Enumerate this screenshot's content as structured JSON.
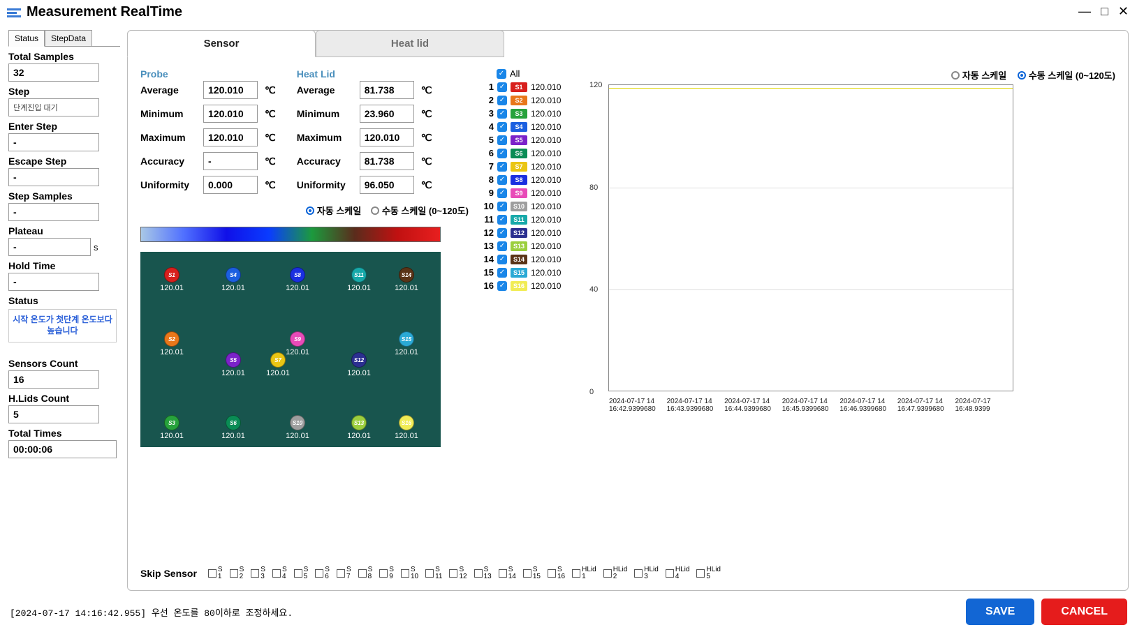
{
  "title": "Measurement RealTime",
  "window": {
    "min": "—",
    "max": "□",
    "close": "✕"
  },
  "side_tabs": {
    "status": "Status",
    "stepdata": "StepData"
  },
  "sidebar": {
    "total_samples_label": "Total Samples",
    "total_samples": "32",
    "step_label": "Step",
    "step": "단계진입 대기",
    "enter_step_label": "Enter Step",
    "enter_step": "-",
    "escape_step_label": "Escape Step",
    "escape_step": "-",
    "step_samples_label": "Step Samples",
    "step_samples": "-",
    "plateau_label": "Plateau",
    "plateau": "-",
    "plateau_unit": "s",
    "hold_time_label": "Hold Time",
    "hold_time": "-",
    "status_label": "Status",
    "status_text": "시작 온도가 첫단계 온도보다 높습니다",
    "sensors_count_label": "Sensors Count",
    "sensors_count": "16",
    "hlids_count_label": "H.Lids Count",
    "hlids_count": "5",
    "total_times_label": "Total Times",
    "total_times": "00:00:06"
  },
  "main_tabs": {
    "sensor": "Sensor",
    "heatlid": "Heat lid"
  },
  "stats": {
    "probe_title": "Probe",
    "heatlid_title": "Heat Lid",
    "avg_label": "Average",
    "min_label": "Minimum",
    "max_label": "Maximum",
    "acc_label": "Accuracy",
    "uni_label": "Uniformity",
    "unit": "℃",
    "probe": {
      "avg": "120.010",
      "min": "120.010",
      "max": "120.010",
      "acc": "-",
      "uni": "0.000"
    },
    "heatlid": {
      "avg": "81.738",
      "min": "23.960",
      "max": "120.010",
      "acc": "81.738",
      "uni": "96.050"
    }
  },
  "scale": {
    "auto": "자동 스케일",
    "manual": "수동 스케일 (0~120도)"
  },
  "all_label": "All",
  "sensors": [
    {
      "n": "1",
      "id": "S1",
      "v": "120.010",
      "c": "#d8201d"
    },
    {
      "n": "2",
      "id": "S2",
      "v": "120.010",
      "c": "#e8771a"
    },
    {
      "n": "3",
      "id": "S3",
      "v": "120.010",
      "c": "#27a23c"
    },
    {
      "n": "4",
      "id": "S4",
      "v": "120.010",
      "c": "#1b5fe0"
    },
    {
      "n": "5",
      "id": "S5",
      "v": "120.010",
      "c": "#7b22c9"
    },
    {
      "n": "6",
      "id": "S6",
      "v": "120.010",
      "c": "#0a8c55"
    },
    {
      "n": "7",
      "id": "S7",
      "v": "120.010",
      "c": "#eac514"
    },
    {
      "n": "8",
      "id": "S8",
      "v": "120.010",
      "c": "#1a2fe0"
    },
    {
      "n": "9",
      "id": "S9",
      "v": "120.010",
      "c": "#e84bb8"
    },
    {
      "n": "10",
      "id": "S10",
      "v": "120.010",
      "c": "#9e9e9e"
    },
    {
      "n": "11",
      "id": "S11",
      "v": "120.010",
      "c": "#17a9a9"
    },
    {
      "n": "12",
      "id": "S12",
      "v": "120.010",
      "c": "#2b2f90"
    },
    {
      "n": "13",
      "id": "S13",
      "v": "120.010",
      "c": "#9ccf3e"
    },
    {
      "n": "14",
      "id": "S14",
      "v": "120.010",
      "c": "#5a3417"
    },
    {
      "n": "15",
      "id": "S15",
      "v": "120.010",
      "c": "#2aa9d5"
    },
    {
      "n": "16",
      "id": "S16",
      "v": "120.010",
      "c": "#f1ec55"
    }
  ],
  "map_value": "120.01",
  "chart_data": {
    "type": "line",
    "y_ticks": [
      0,
      40,
      80,
      120
    ],
    "ylim": [
      0,
      120
    ],
    "x_ticks": [
      "2024-07-17 14\n16:42.9399680",
      "2024-07-17 14\n16:43.9399680",
      "2024-07-17 14\n16:44.9399680",
      "2024-07-17 14\n16:45.9399680",
      "2024-07-17 14\n16:46.9399680",
      "2024-07-17 14\n16:47.9399680",
      "2024-07-17\n16:48.9399"
    ],
    "series": [
      {
        "name": "S1",
        "values": [
          120,
          120,
          120,
          120,
          120,
          120,
          120
        ]
      },
      {
        "name": "S2",
        "values": [
          120,
          120,
          120,
          120,
          120,
          120,
          120
        ]
      },
      {
        "name": "S3",
        "values": [
          120,
          120,
          120,
          120,
          120,
          120,
          120
        ]
      },
      {
        "name": "S4",
        "values": [
          120,
          120,
          120,
          120,
          120,
          120,
          120
        ]
      },
      {
        "name": "S5",
        "values": [
          120,
          120,
          120,
          120,
          120,
          120,
          120
        ]
      },
      {
        "name": "S6",
        "values": [
          120,
          120,
          120,
          120,
          120,
          120,
          120
        ]
      },
      {
        "name": "S7",
        "values": [
          120,
          120,
          120,
          120,
          120,
          120,
          120
        ]
      },
      {
        "name": "S8",
        "values": [
          120,
          120,
          120,
          120,
          120,
          120,
          120
        ]
      },
      {
        "name": "S9",
        "values": [
          120,
          120,
          120,
          120,
          120,
          120,
          120
        ]
      },
      {
        "name": "S10",
        "values": [
          120,
          120,
          120,
          120,
          120,
          120,
          120
        ]
      },
      {
        "name": "S11",
        "values": [
          120,
          120,
          120,
          120,
          120,
          120,
          120
        ]
      },
      {
        "name": "S12",
        "values": [
          120,
          120,
          120,
          120,
          120,
          120,
          120
        ]
      },
      {
        "name": "S13",
        "values": [
          120,
          120,
          120,
          120,
          120,
          120,
          120
        ]
      },
      {
        "name": "S14",
        "values": [
          120,
          120,
          120,
          120,
          120,
          120,
          120
        ]
      },
      {
        "name": "S15",
        "values": [
          120,
          120,
          120,
          120,
          120,
          120,
          120
        ]
      },
      {
        "name": "S16",
        "values": [
          120,
          120,
          120,
          120,
          120,
          120,
          120
        ]
      }
    ]
  },
  "skip": {
    "label": "Skip Sensor",
    "items": [
      "S 1",
      "S 2",
      "S 3",
      "S 4",
      "S 5",
      "S 6",
      "S 7",
      "S 8",
      "S 9",
      "S 10",
      "S 11",
      "S 12",
      "S 13",
      "S 14",
      "S 15",
      "S 16",
      "HLid 1",
      "HLid 2",
      "HLid 3",
      "HLid 4",
      "HLid 5"
    ]
  },
  "log": "[2024-07-17 14:16:42.955] 우선 온도를 80이하로 조정하세요.",
  "btn": {
    "save": "SAVE",
    "cancel": "CANCEL"
  }
}
